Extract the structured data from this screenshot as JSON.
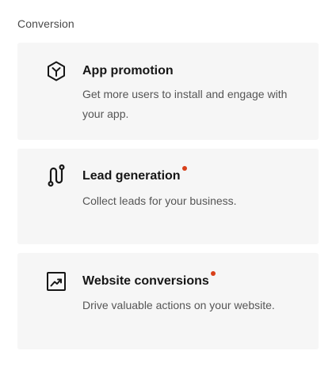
{
  "section": {
    "title": "Conversion"
  },
  "cards": [
    {
      "title": "App promotion",
      "description": "Get more users to install and engage with your app.",
      "icon": "app-promotion-hexagon-icon",
      "new_indicator": false
    },
    {
      "title": "Lead generation",
      "description": "Collect leads for your business.",
      "icon": "lead-generation-path-icon",
      "new_indicator": true
    },
    {
      "title": "Website conversions",
      "description": "Drive valuable actions on your website.",
      "icon": "website-conversions-trend-icon",
      "new_indicator": true
    }
  ],
  "colors": {
    "card_background": "#f6f6f6",
    "new_indicator": "#d8401a",
    "title_text": "#161616",
    "description_text": "#555555"
  }
}
